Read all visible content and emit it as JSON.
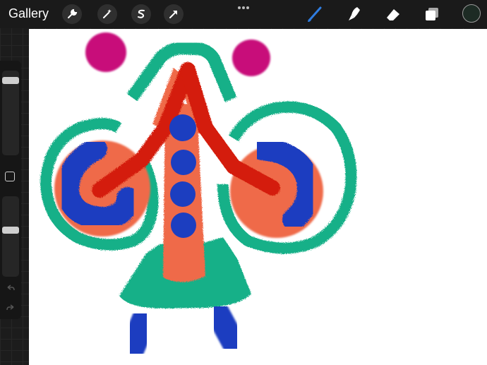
{
  "toolbar": {
    "gallery_label": "Gallery",
    "left_tools": [
      {
        "icon": "wrench-icon",
        "name": "actions"
      },
      {
        "icon": "magic-wand-icon",
        "name": "adjustments"
      },
      {
        "icon": "selection-s-icon",
        "name": "selection"
      },
      {
        "icon": "arrow-cursor-icon",
        "name": "transform"
      }
    ],
    "right_tools": [
      {
        "icon": "brush-icon",
        "name": "paint",
        "active": true,
        "color": "#2f7de1"
      },
      {
        "icon": "smudge-icon",
        "name": "smudge"
      },
      {
        "icon": "eraser-icon",
        "name": "erase"
      },
      {
        "icon": "layers-icon",
        "name": "layers"
      }
    ],
    "current_color": "#1d2b24"
  },
  "sidebar": {
    "brush_size_slider": "brush-size",
    "opacity_slider": "opacity",
    "modify_button": "modify",
    "undo": "undo",
    "redo": "redo"
  },
  "canvas": {
    "background": "#ffffff",
    "palette": {
      "teal": "#16b088",
      "orange": "#ef6a4a",
      "red": "#d41e08",
      "blue": "#1c3ec0",
      "magenta": "#c8087a"
    }
  }
}
